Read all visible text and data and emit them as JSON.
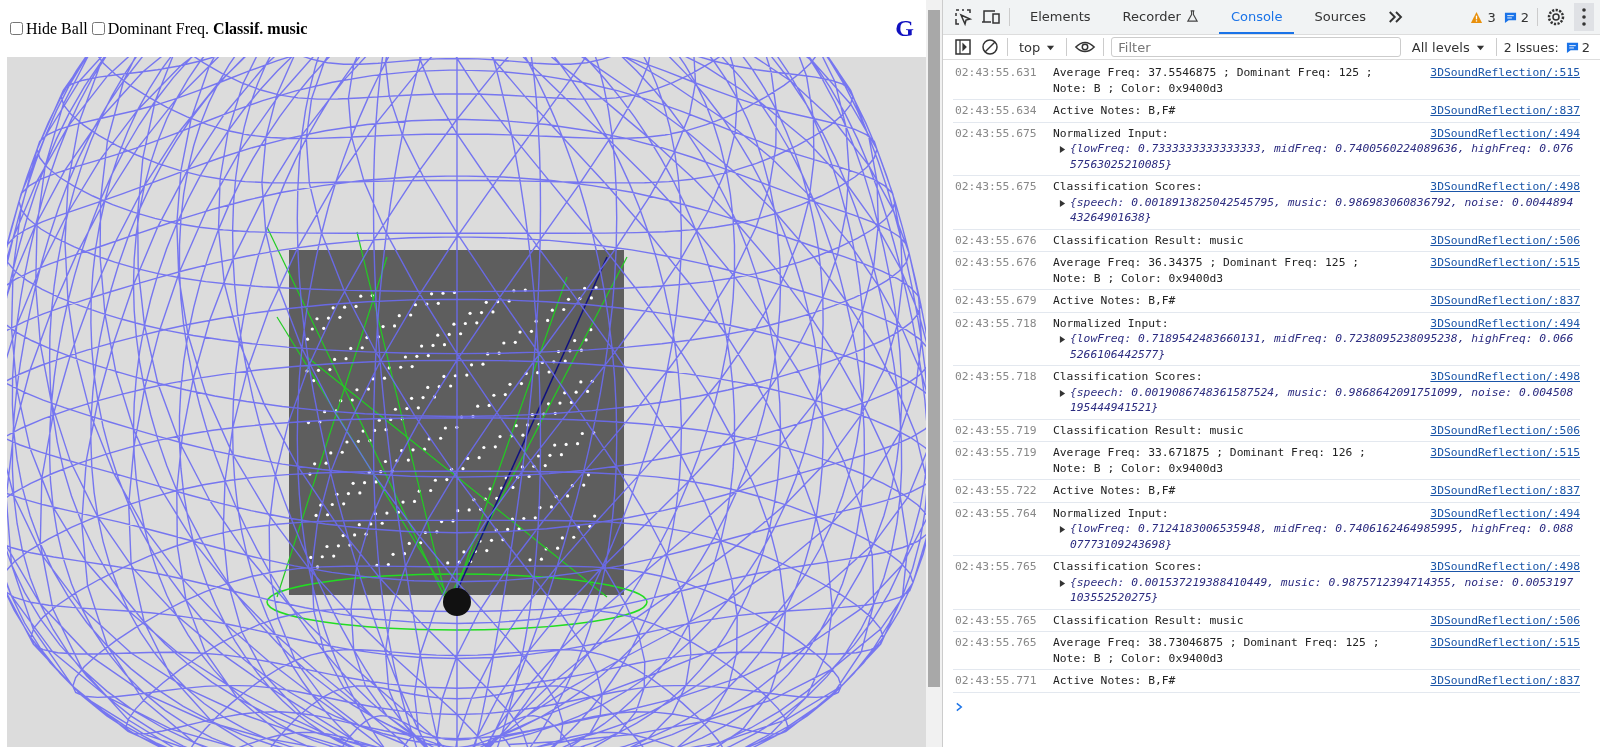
{
  "page": {
    "controls": [
      {
        "kind": "checkbox",
        "label": "Hide Ball",
        "checked": false
      },
      {
        "kind": "checkbox",
        "label": "Dominant Freq.",
        "checked": false
      },
      {
        "kind": "status",
        "label": "Classif. music"
      }
    ],
    "corner_link": "G"
  },
  "devtools": {
    "tabs": [
      {
        "label": "Elements",
        "selected": false,
        "experimental": false
      },
      {
        "label": "Recorder",
        "selected": false,
        "experimental": true
      },
      {
        "label": "Console",
        "selected": true,
        "experimental": false
      },
      {
        "label": "Sources",
        "selected": false,
        "experimental": false
      }
    ],
    "warnings": "3",
    "messages": "2",
    "context": "top",
    "filter": {
      "placeholder": "Filter"
    },
    "levels": "All levels",
    "issues": {
      "label": "2 Issues:",
      "count": "2"
    }
  },
  "console": {
    "entries": [
      {
        "kind": "text",
        "time": "02:43:55.631",
        "message": "Average Freq: 37.5546875 ; Dominant Freq: 125 ; Note: B ; Color: 0x9400d3",
        "source": "3DSoundReflection/:515"
      },
      {
        "kind": "text",
        "time": "02:43:55.634",
        "message": "Active Notes: B,F#",
        "source": "3DSoundReflection/:837"
      },
      {
        "kind": "object",
        "time": "02:43:55.675",
        "message": "Normalized Input:",
        "preview": "{lowFreq: 0.7333333333333333, midFreq: 0.7400560224089636, highFreq: 0.07657563025210085}",
        "source": "3DSoundReflection/:494"
      },
      {
        "kind": "object",
        "time": "02:43:55.675",
        "message": "Classification Scores:",
        "preview": "{speech: 0.0018913825042545795, music: 0.986983060836792, noise: 0.004489443264901638}",
        "source": "3DSoundReflection/:498"
      },
      {
        "kind": "text",
        "time": "02:43:55.676",
        "message": "Classification Result: music",
        "source": "3DSoundReflection/:506"
      },
      {
        "kind": "text",
        "time": "02:43:55.676",
        "message": "Average Freq: 36.34375 ; Dominant Freq: 125 ; Note: B ; Color: 0x9400d3",
        "source": "3DSoundReflection/:515"
      },
      {
        "kind": "text",
        "time": "02:43:55.679",
        "message": "Active Notes: B,F#",
        "source": "3DSoundReflection/:837"
      },
      {
        "kind": "object",
        "time": "02:43:55.718",
        "message": "Normalized Input:",
        "preview": "{lowFreq: 0.7189542483660131, midFreq: 0.7238095238095238, highFreq: 0.0665266106442577}",
        "source": "3DSoundReflection/:494"
      },
      {
        "kind": "object",
        "time": "02:43:55.718",
        "message": "Classification Scores:",
        "preview": "{speech: 0.0019086748361587524, music: 0.9868642091751099, noise: 0.004508195444941521}",
        "source": "3DSoundReflection/:498"
      },
      {
        "kind": "text",
        "time": "02:43:55.719",
        "message": "Classification Result: music",
        "source": "3DSoundReflection/:506"
      },
      {
        "kind": "text",
        "time": "02:43:55.719",
        "message": "Average Freq: 33.671875 ; Dominant Freq: 126 ; Note: B ; Color: 0x9400d3",
        "source": "3DSoundReflection/:515"
      },
      {
        "kind": "text",
        "time": "02:43:55.722",
        "message": "Active Notes: B,F#",
        "source": "3DSoundReflection/:837"
      },
      {
        "kind": "object",
        "time": "02:43:55.764",
        "message": "Normalized Input:",
        "preview": "{lowFreq: 0.7124183006535948, midFreq: 0.7406162464985995, highFreq: 0.08807773109243698}",
        "source": "3DSoundReflection/:494"
      },
      {
        "kind": "object",
        "time": "02:43:55.765",
        "message": "Classification Scores:",
        "preview": "{speech: 0.001537219388410449, music: 0.9875712394714355, noise: 0.0053197103552520275}",
        "source": "3DSoundReflection/:498"
      },
      {
        "kind": "text",
        "time": "02:43:55.765",
        "message": "Classification Result: music",
        "source": "3DSoundReflection/:506"
      },
      {
        "kind": "text",
        "time": "02:43:55.765",
        "message": "Average Freq: 38.73046875 ; Dominant Freq: 125 ; Note: B ; Color: 0x9400d3",
        "source": "3DSoundReflection/:515"
      },
      {
        "kind": "text",
        "time": "02:43:55.771",
        "message": "Active Notes: B,F#",
        "source": "3DSoundReflection/:837"
      }
    ]
  }
}
